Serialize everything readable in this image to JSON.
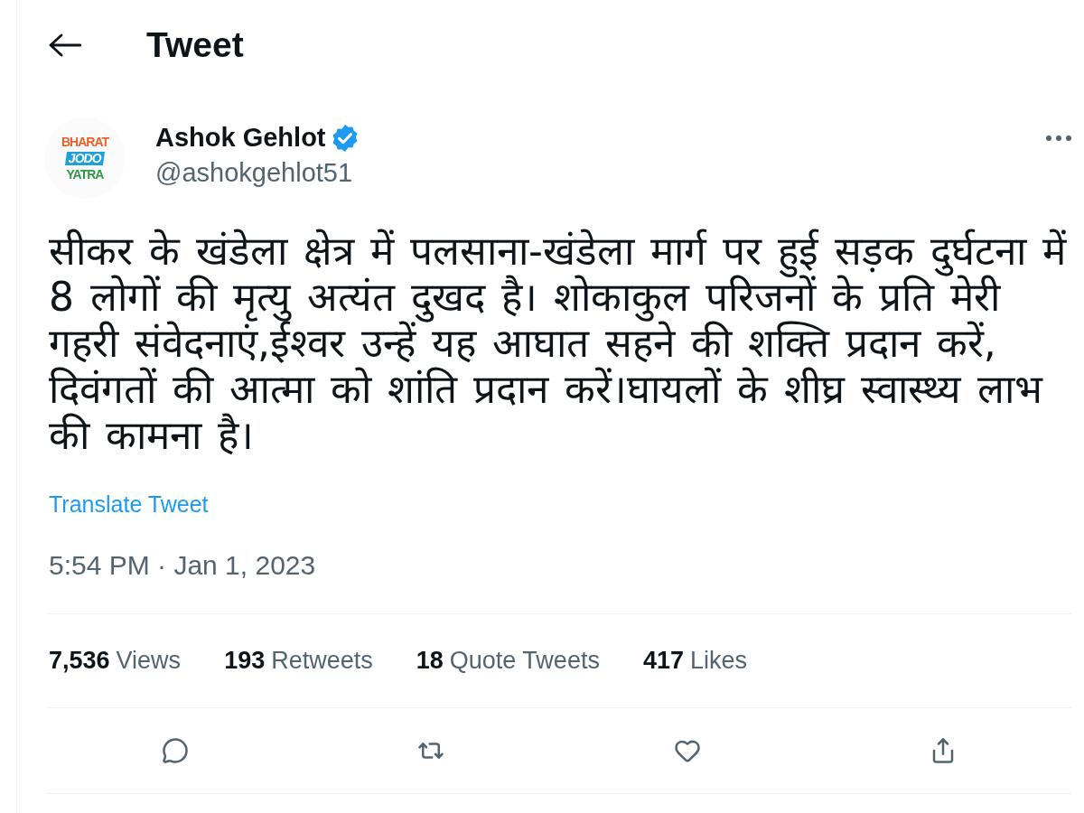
{
  "header": {
    "title": "Tweet"
  },
  "tweet": {
    "author": {
      "name": "Ashok Gehlot",
      "handle": "@ashokgehlot51",
      "verified": true,
      "avatar_logo": [
        "BHARAT",
        "JODO",
        "YATRA"
      ]
    },
    "text": "सीकर के खंडेला क्षेत्र में पलसाना-खंडेला मार्ग पर हुई सड़क दुर्घटना में 8 लोगों की मृत्यु अत्यंत दुखद है। शोकाकुल परिजनों के प्रति मेरी गहरी संवेदनाएं,ईश्वर उन्हें यह आघात सहने की शक्ति प्रदान करें, दिवंगतों की आत्मा को शांति प्रदान करें।घायलों के शीघ्र स्वास्थ्य लाभ की कामना है।",
    "translate_link": "Translate Tweet",
    "timestamp": "5:54 PM · Jan 1, 2023",
    "stats": [
      {
        "count": "7,536",
        "label": "Views"
      },
      {
        "count": "193",
        "label": "Retweets"
      },
      {
        "count": "18",
        "label": "Quote Tweets"
      },
      {
        "count": "417",
        "label": "Likes"
      }
    ],
    "actions": [
      {
        "kind": "reply"
      },
      {
        "kind": "retweet"
      },
      {
        "kind": "like"
      },
      {
        "kind": "share"
      }
    ]
  }
}
